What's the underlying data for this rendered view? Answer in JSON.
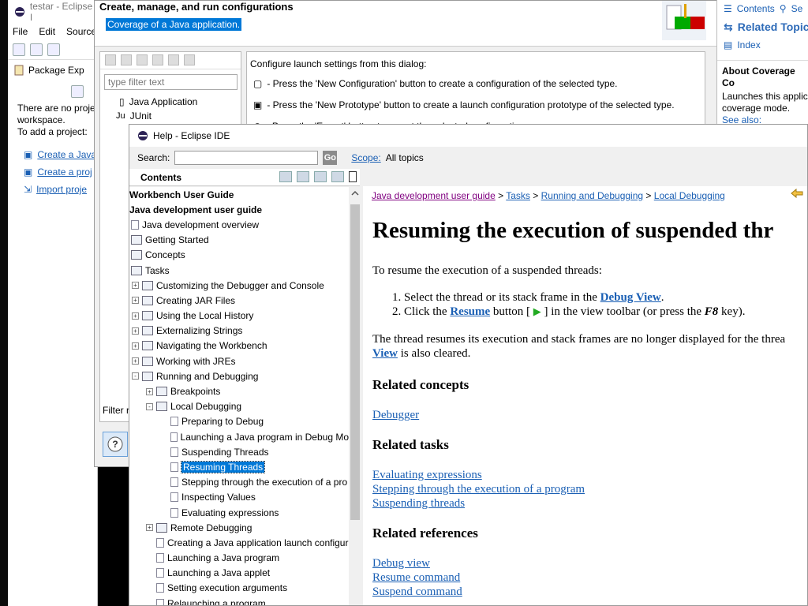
{
  "eclipse": {
    "title": "testar - Eclipse I",
    "menu": [
      "File",
      "Edit",
      "Source"
    ],
    "view_title": "Package Exp",
    "message": "There are no projec\nworkspace.\nTo add a project:",
    "links": [
      "Create a Java",
      "Create a proj",
      "Import proje"
    ]
  },
  "launch": {
    "title": "Create, manage, and run configurations",
    "subtitle": "Coverage of a Java application.",
    "filter_placeholder": "type filter text",
    "tree": [
      "Java Application",
      "JUnit"
    ],
    "intro": "Configure launch settings from this dialog:",
    "lines": [
      "- Press the 'New Configuration' button to create a configuration of the selected type.",
      "- Press the 'New Prototype' button to create a launch configuration prototype of the selected type.",
      "- Press the 'Export' button to export the selected configurations."
    ],
    "filter_label": "Filter r"
  },
  "rightpanel": {
    "contents": "Contents",
    "search": "Se",
    "related": "Related Topics",
    "index": "Index",
    "about_title": "About Coverage Co",
    "about_text": "Launches this applic\ncoverage mode.",
    "see_also": "See also:"
  },
  "help": {
    "title": "Help - Eclipse IDE",
    "search_label": "Search:",
    "go": "Go",
    "scope_link": "Scope:",
    "scope_value": "All topics",
    "contents_label": "Contents",
    "toc": [
      {
        "label": "Workbench User Guide",
        "level": 0,
        "type": "bold"
      },
      {
        "label": "Java development user guide",
        "level": 0,
        "type": "bold"
      },
      {
        "label": "Java development overview",
        "level": 0,
        "type": "page"
      },
      {
        "label": "Getting Started",
        "level": 0,
        "type": "book"
      },
      {
        "label": "Concepts",
        "level": 0,
        "type": "book"
      },
      {
        "label": "Tasks",
        "level": 0,
        "type": "book"
      },
      {
        "label": "Customizing the Debugger and Console",
        "level": 1,
        "type": "book",
        "exp": "+"
      },
      {
        "label": "Creating JAR Files",
        "level": 1,
        "type": "book",
        "exp": "+"
      },
      {
        "label": "Using the Local History",
        "level": 1,
        "type": "book",
        "exp": "+"
      },
      {
        "label": "Externalizing Strings",
        "level": 1,
        "type": "book",
        "exp": "+"
      },
      {
        "label": "Navigating the Workbench",
        "level": 1,
        "type": "book",
        "exp": "+"
      },
      {
        "label": "Working with JREs",
        "level": 1,
        "type": "book",
        "exp": "+"
      },
      {
        "label": "Running and Debugging",
        "level": 1,
        "type": "book",
        "exp": "-"
      },
      {
        "label": "Breakpoints",
        "level": 2,
        "type": "book",
        "exp": "+"
      },
      {
        "label": "Local Debugging",
        "level": 2,
        "type": "book",
        "exp": "-"
      },
      {
        "label": "Preparing to Debug",
        "level": 3,
        "type": "page"
      },
      {
        "label": "Launching a Java program in Debug Mo",
        "level": 3,
        "type": "page"
      },
      {
        "label": "Suspending Threads",
        "level": 3,
        "type": "page"
      },
      {
        "label": "Resuming Threads",
        "level": 3,
        "type": "page",
        "selected": true
      },
      {
        "label": "Stepping through the execution of a pro",
        "level": 3,
        "type": "page"
      },
      {
        "label": "Inspecting Values",
        "level": 3,
        "type": "page"
      },
      {
        "label": "Evaluating expressions",
        "level": 3,
        "type": "page"
      },
      {
        "label": "Remote Debugging",
        "level": 2,
        "type": "book",
        "exp": "+"
      },
      {
        "label": "Creating a Java application launch configur",
        "level": 2,
        "type": "page"
      },
      {
        "label": "Launching a Java program",
        "level": 2,
        "type": "page"
      },
      {
        "label": "Launching a Java applet",
        "level": 2,
        "type": "page"
      },
      {
        "label": "Setting execution arguments",
        "level": 2,
        "type": "page"
      },
      {
        "label": "Relaunching a program",
        "level": 2,
        "type": "page"
      }
    ],
    "breadcrumb": [
      "Java development user guide",
      "Tasks",
      "Running and Debugging",
      "Local Debugging"
    ],
    "heading": "Resuming the execution of suspended thr",
    "intro": "To resume the execution of a suspended threads:",
    "step1_pre": "Select the thread or its stack frame in the ",
    "step1_link": "Debug View",
    "step1_post": ".",
    "step2_pre": "Click the ",
    "step2_link": "Resume",
    "step2_mid": " button [ ",
    "step2_post": " ] in the view toolbar (or press the ",
    "step2_key": "F8",
    "step2_end": " key).",
    "para_pre": "The thread resumes its execution and stack frames are no longer displayed for the threa",
    "para_link": "View",
    "para_post": " is also cleared.",
    "related_concepts": "Related concepts",
    "concepts": [
      "Debugger"
    ],
    "related_tasks": "Related tasks",
    "tasks": [
      "Evaluating expressions",
      "Stepping through the execution of a program",
      "Suspending threads"
    ],
    "related_refs": "Related references",
    "refs": [
      "Debug view",
      "Resume command",
      "Suspend command"
    ]
  }
}
